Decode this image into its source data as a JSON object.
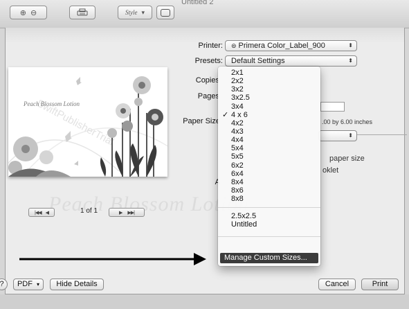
{
  "window": {
    "title": "Untitled 2"
  },
  "toolbar": {
    "style_label": "Style",
    "style_arrow": "▾"
  },
  "preview": {
    "caption": "Peach Blossom Lotion",
    "watermark": "SwiftPublisherTrial"
  },
  "ghost_text": "Peach Blossom Lotion",
  "page_nav": {
    "first": "|◀◀",
    "prev": "◀",
    "indicator": "1 of 1",
    "next": "▶",
    "last": "▶▶|"
  },
  "labels": {
    "printer": "Printer:",
    "presets": "Presets:",
    "copies": "Copies",
    "pages": "Pages",
    "paper_size": "Paper Size",
    "a": "A"
  },
  "printer_popup": {
    "value": "Primera Color_Label_900",
    "icon": "printer-icon"
  },
  "presets_popup": {
    "value": "Default Settings"
  },
  "paper_size_value": "4 x 6",
  "paper_dimensions": ".00 by 6.00 inches",
  "scale_option": "paper size",
  "booklet_option": "oklet",
  "paper_menu": {
    "items": [
      "2x1",
      "2x2",
      "3x2",
      "3x2.5",
      "3x4",
      "4 x 6",
      "4x2",
      "4x3",
      "4x4",
      "5x4",
      "5x5",
      "6x2",
      "6x4",
      "8x4",
      "8x6",
      "8x8"
    ],
    "checked": "4 x 6",
    "custom_items": [
      "2.5x2.5",
      "Untitled"
    ],
    "manage": "Manage Custom Sizes...",
    "check_mark": "✓"
  },
  "bottom": {
    "help": "?",
    "pdf": "PDF",
    "pdf_arrow": "▾",
    "hide_details": "Hide Details",
    "cancel": "Cancel",
    "print": "Print"
  },
  "colors": {
    "menu_highlight": "#3b3b3b",
    "annotation_arrow": "#000000"
  }
}
